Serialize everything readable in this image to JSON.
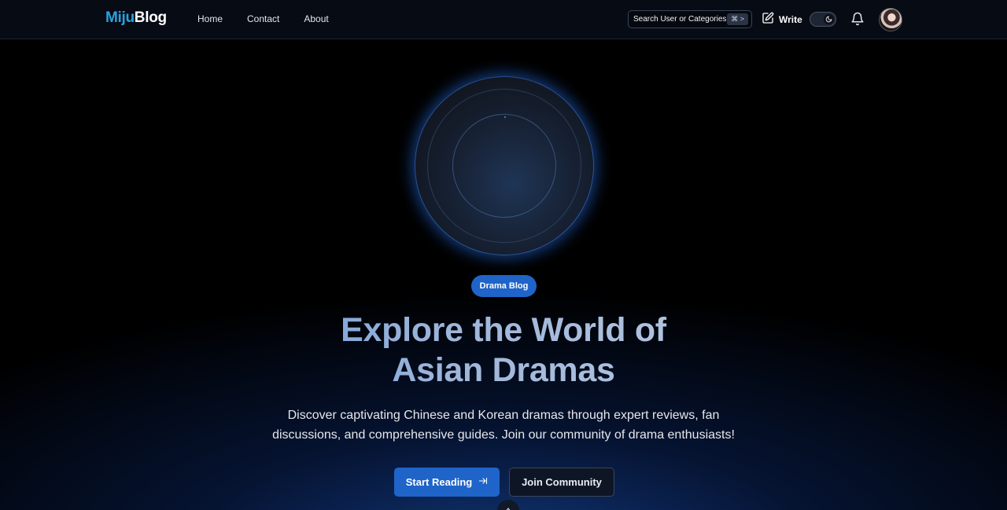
{
  "brand": {
    "part1": "Miju",
    "part2": "Blog"
  },
  "nav": {
    "items": [
      {
        "label": "Home"
      },
      {
        "label": "Contact"
      },
      {
        "label": "About"
      }
    ]
  },
  "search": {
    "placeholder": "Search User or Categories...",
    "shortcut": "⌘ >"
  },
  "actions": {
    "write_label": "Write"
  },
  "hero": {
    "badge": "Drama Blog",
    "title_line1": "Explore the World of",
    "title_line2": "Asian Dramas",
    "subtitle": "Discover captivating Chinese and Korean dramas through expert reviews, fan discussions, and comprehensive guides. Join our community of drama enthusiasts!",
    "primary_button": "Start Reading",
    "secondary_button": "Join Community"
  },
  "icons": [
    "edit-icon",
    "moon-icon",
    "bell-icon",
    "arrow-right-to-line-icon",
    "chevron-up-icon"
  ],
  "colors": {
    "accent": "#1f64c8",
    "brand_blue": "#29a3e0",
    "background": "#000000"
  }
}
